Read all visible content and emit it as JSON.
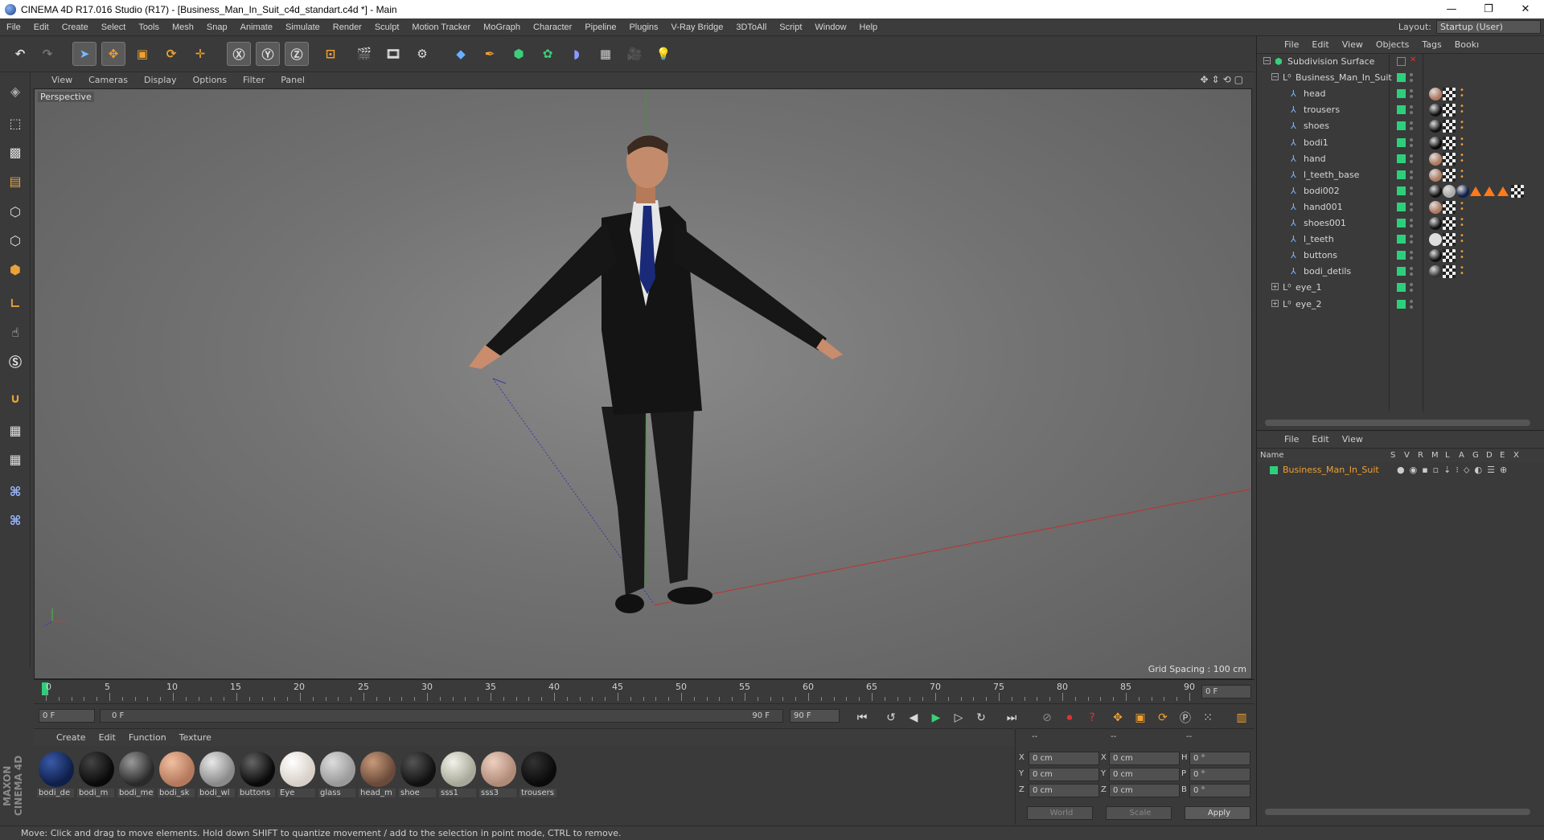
{
  "window": {
    "title": "CINEMA 4D R17.016 Studio (R17) - [Business_Man_In_Suit_c4d_standart.c4d *] - Main",
    "controls": [
      "—",
      "❐",
      "✕"
    ]
  },
  "menu": [
    "File",
    "Edit",
    "Create",
    "Select",
    "Tools",
    "Mesh",
    "Snap",
    "Animate",
    "Simulate",
    "Render",
    "Sculpt",
    "Motion Tracker",
    "MoGraph",
    "Character",
    "Pipeline",
    "Plugins",
    "V-Ray Bridge",
    "3DToAll",
    "Script",
    "Window",
    "Help"
  ],
  "layout": {
    "label": "Layout:",
    "value": "Startup (User)"
  },
  "viewport": {
    "menu": [
      "View",
      "Cameras",
      "Display",
      "Options",
      "Filter",
      "Panel"
    ],
    "label": "Perspective",
    "grid_spacing": "Grid Spacing : 100 cm"
  },
  "timeline": {
    "ticks": [
      "0",
      "5",
      "10",
      "15",
      "20",
      "25",
      "30",
      "35",
      "40",
      "45",
      "50",
      "55",
      "60",
      "65",
      "70",
      "75",
      "80",
      "85",
      "90"
    ],
    "frame_right": "0 F",
    "current_frame": "0 F",
    "range_start": "0 F",
    "range_end": "90 F",
    "end_frame": "90 F"
  },
  "materials": {
    "menu": [
      "Create",
      "Edit",
      "Function",
      "Texture"
    ],
    "items": [
      {
        "name": "bodi_de",
        "color": "#0e1f4a",
        "hi": "#3a5aa8"
      },
      {
        "name": "bodi_m",
        "color": "#0a0a0a",
        "hi": "#444"
      },
      {
        "name": "bodi_me",
        "color": "#2a2a2a",
        "hi": "#9a9a9a"
      },
      {
        "name": "bodi_sk",
        "color": "#b5785c",
        "hi": "#f0c0a0"
      },
      {
        "name": "bodi_wl",
        "color": "#8a8a8a",
        "hi": "#e8e8e8"
      },
      {
        "name": "buttons",
        "color": "#0a0a0a",
        "hi": "#666"
      },
      {
        "name": "Eye",
        "color": "#d8d0c8",
        "hi": "#fff"
      },
      {
        "name": "glass",
        "color": "#9a9a9a",
        "hi": "#ddd"
      },
      {
        "name": "head_m",
        "color": "#6a4a3a",
        "hi": "#c89a7a"
      },
      {
        "name": "shoe",
        "color": "#111",
        "hi": "#555"
      },
      {
        "name": "sss1",
        "color": "#a8a89a",
        "hi": "#f2f2e8"
      },
      {
        "name": "sss3",
        "color": "#b08a78",
        "hi": "#eed0c0"
      },
      {
        "name": "trousers",
        "color": "#0a0a0a",
        "hi": "#333"
      }
    ]
  },
  "coords": {
    "headers": [
      "--",
      "--",
      "--"
    ],
    "rows": [
      {
        "a": "X",
        "av": "0 cm",
        "b": "X",
        "bv": "0 cm",
        "c": "H",
        "cv": "0 °"
      },
      {
        "a": "Y",
        "av": "0 cm",
        "b": "Y",
        "bv": "0 cm",
        "c": "P",
        "cv": "0 °"
      },
      {
        "a": "Z",
        "av": "0 cm",
        "b": "Z",
        "bv": "0 cm",
        "c": "B",
        "cv": "0 °"
      }
    ],
    "world": "World",
    "scale": "Scale",
    "apply": "Apply"
  },
  "objects_panel": {
    "menu": [
      "File",
      "Edit",
      "View",
      "Objects",
      "Tags",
      "Bookı"
    ],
    "tree": [
      {
        "name": "Subdivision Surface",
        "level": 0,
        "kind": "subdiv",
        "tags": []
      },
      {
        "name": "Business_Man_In_Suit",
        "level": 1,
        "kind": "null",
        "tags": []
      },
      {
        "name": "head",
        "level": 2,
        "kind": "bone",
        "tags": [
          "#b07a60",
          "chk",
          "or"
        ]
      },
      {
        "name": "trousers",
        "level": 2,
        "kind": "bone",
        "tags": [
          "#111",
          "chk",
          "or"
        ]
      },
      {
        "name": "shoes",
        "level": 2,
        "kind": "bone",
        "tags": [
          "#111",
          "chk",
          "or"
        ]
      },
      {
        "name": "bodi1",
        "level": 2,
        "kind": "bone",
        "tags": [
          "#0a0a0a",
          "chk",
          "or"
        ]
      },
      {
        "name": "hand",
        "level": 2,
        "kind": "bone",
        "tags": [
          "#b07a60",
          "chk",
          "or"
        ]
      },
      {
        "name": "l_teeth_base",
        "level": 2,
        "kind": "bone",
        "tags": [
          "#b07a60",
          "chk",
          "or"
        ]
      },
      {
        "name": "bodi002",
        "level": 2,
        "kind": "bone",
        "tags": [
          "#111",
          "#aaa",
          "#0e1f4a",
          "tri",
          "tri",
          "tri",
          "chk"
        ]
      },
      {
        "name": "hand001",
        "level": 2,
        "kind": "bone",
        "tags": [
          "#b07a60",
          "chk",
          "or"
        ]
      },
      {
        "name": "shoes001",
        "level": 2,
        "kind": "bone",
        "tags": [
          "#111",
          "chk",
          "or"
        ]
      },
      {
        "name": "l_teeth",
        "level": 2,
        "kind": "bone",
        "tags": [
          "#ddd",
          "chk",
          "or"
        ]
      },
      {
        "name": "buttons",
        "level": 2,
        "kind": "bone",
        "tags": [
          "#111",
          "chk",
          "or"
        ]
      },
      {
        "name": "bodi_detils",
        "level": 2,
        "kind": "bone",
        "tags": [
          "#333",
          "chk",
          "or"
        ]
      },
      {
        "name": "eye_1",
        "level": 1,
        "kind": "nullplus",
        "tags": []
      },
      {
        "name": "eye_2",
        "level": 1,
        "kind": "nullplus",
        "tags": []
      }
    ]
  },
  "layers_panel": {
    "menu": [
      "File",
      "Edit",
      "View"
    ],
    "columns": [
      "Name",
      "S",
      "V",
      "R",
      "M",
      "L",
      "A",
      "G",
      "D",
      "E",
      "X"
    ],
    "rows": [
      {
        "name": "Business_Man_In_Suit",
        "color": "#2dd07a"
      }
    ]
  },
  "status": "Move: Click and drag to move elements. Hold down SHIFT to quantize movement / add to the selection in point mode, CTRL to remove.",
  "brand": "MAXON CINEMA 4D",
  "colors": {
    "accent": "#f09a30",
    "visible": "#2dd07a",
    "layer_text": "#f0a030"
  }
}
